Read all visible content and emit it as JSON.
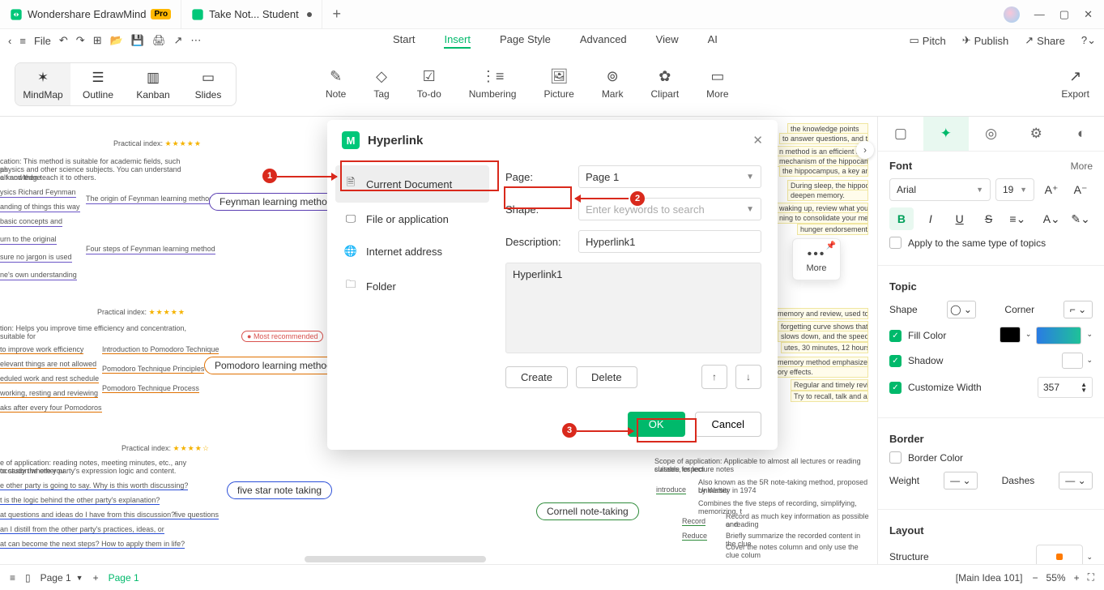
{
  "titlebar": {
    "tab1": "Wondershare EdrawMind",
    "pro": "Pro",
    "tab2": "Take Not... Student"
  },
  "toolbar": {
    "file": "File",
    "menus": {
      "start": "Start",
      "insert": "Insert",
      "pagestyle": "Page Style",
      "advanced": "Advanced",
      "view": "View",
      "ai": "AI"
    },
    "right": {
      "pitch": "Pitch",
      "publish": "Publish",
      "share": "Share"
    }
  },
  "viewmodes": {
    "mindmap": "MindMap",
    "outline": "Outline",
    "kanban": "Kanban",
    "slides": "Slides"
  },
  "ribbon": {
    "note": "Note",
    "tag": "Tag",
    "todo": "To-do",
    "numbering": "Numbering",
    "picture": "Picture",
    "mark": "Mark",
    "clipart": "Clipart",
    "more": "More",
    "export": "Export"
  },
  "canvas": {
    "feynman": "Feynman learning method",
    "pomodoro": "Pomodoro learning method",
    "fivestar": "five star note taking",
    "cornell": "Cornell note-taking",
    "most": "Most recommended",
    "practical": "Practical index:",
    "t1": "cation: This method is suitable for academic fields, such as",
    "t1b": "physics and other science subjects. You can understand a knowledge",
    "t1c": "elf and then teach it to others.",
    "t2": "ysics Richard Feynman",
    "t3": "anding of things this way",
    "t4": "basic concepts and",
    "t5": "urn to the original",
    "t6": "sure no jargon is used",
    "t7": "ne's own understanding",
    "t8": "The origin of Feynman learning method",
    "t9": "Four steps of Feynman learning method",
    "p0": "tion: Helps you improve time efficiency and concentration, suitable for",
    "p1": "to improve work efficiency",
    "p2": "elevant things are not allowed",
    "p3": "eduled work and rest schedule",
    "p4": "working, resting and reviewing",
    "p5": "aks after every four Pomodoros",
    "p6": "Introduction to Pomodoro Technique",
    "p7": "Pomodoro Technique Principles",
    "p8": "Pomodoro Technique Process",
    "f0": "e of application: reading notes, meeting minutes, etc., any occasion where you",
    "f0b": "to study the other party's expression logic and content.",
    "f1": "e other party is going to say. Why is this worth discussing?",
    "f2": "t is the logic behind the other party's explanation?",
    "f3": "at questions and ideas do I have from this discussion?",
    "f4": "an I distill from the other party's practices, ideas, or",
    "f5": "at can become the next steps? How to apply them in life?",
    "f6": "five questions",
    "c1": "Scope of application: Applicable to almost all lectures or reading classes, especi",
    "c1b": "suitable for lecture notes",
    "c2": "Also known as the 5R note-taking method, proposed by Walter",
    "c2b": "University in 1974",
    "c3": "Combines the five steps of recording, simplifying, memorizing, t",
    "c4": "Record as much key information as possible and",
    "c4b": "or reading",
    "c5": "Briefly summarize the recorded content in the clue",
    "c6": "Cover the notes column and only use the clue colum",
    "c_intro": "introduce",
    "c_rec": "Record",
    "c_red": "Reduce",
    "bg1": "the knowledge points",
    "bg2": "to answer questions, and t",
    "bg3": "n method is an efficient lea",
    "bg4": "mechanism of the hippocam",
    "bg5": "the hippocampus, a key ar",
    "bg6": "During sleep, the hippocamp",
    "bg7": "deepen memory.",
    "bg8": "waking up, review what you h",
    "bg9": "ning to consolidate your memor",
    "bg10": "hunger endorsement",
    "bg11": "memory and review, used to co",
    "bg12": "forgetting curve shows that afte",
    "bg13": "slows down, and the speed of",
    "bg14": "utes, 30 minutes, 12 hours,",
    "bg15": "memory method emphasizes",
    "bg16": "ory effects.",
    "bg17": "Regular and timely review a",
    "bg18": "Try to recall, talk and argue"
  },
  "modal": {
    "title": "Hyperlink",
    "side": {
      "current": "Current Document",
      "file": "File or application",
      "internet": "Internet address",
      "folder": "Folder"
    },
    "form": {
      "page_l": "Page:",
      "page_v": "Page 1",
      "shape_l": "Shape:",
      "shape_ph": "Enter keywords to search",
      "desc_l": "Description:",
      "desc_v": "Hyperlink1",
      "list": "Hyperlink1",
      "create": "Create",
      "delete": "Delete",
      "ok": "OK",
      "cancel": "Cancel"
    }
  },
  "moremenu": {
    "label": "More"
  },
  "rpanel": {
    "font": "Font",
    "more": "More",
    "fontname": "Arial",
    "fontsize": "19",
    "apply": "Apply to the same type of topics",
    "topic": "Topic",
    "shape": "Shape",
    "corner": "Corner",
    "fill": "Fill Color",
    "shadow": "Shadow",
    "custwidth": "Customize Width",
    "width": "357",
    "border": "Border",
    "bordercolor": "Border Color",
    "weight": "Weight",
    "dashes": "Dashes",
    "layout": "Layout",
    "structure": "Structure"
  },
  "status": {
    "page": "Page 1",
    "pageactive": "Page 1",
    "main": "[Main Idea 101]",
    "zoom": "55%"
  }
}
